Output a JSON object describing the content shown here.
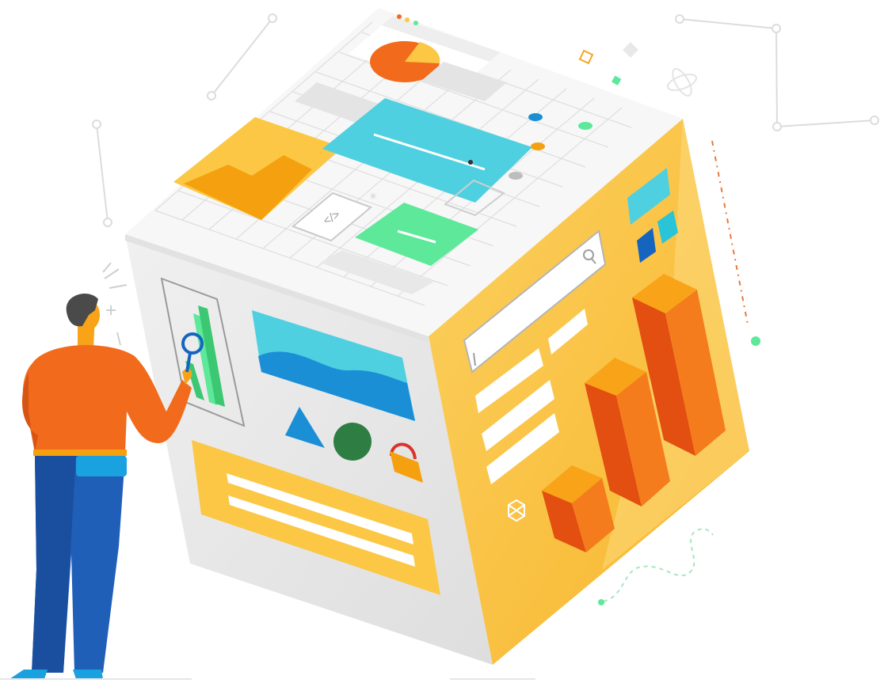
{
  "illustration": {
    "subject": "isometric-ui-cube-with-person",
    "colors": {
      "top_face": "#f6f6f6",
      "left_face": "#e9e9e9",
      "right_face": "#fbc744",
      "accent_orange": "#f26b1d",
      "accent_cyan": "#4fd0e0",
      "accent_green": "#5de89a",
      "accent_blue": "#1565c0",
      "accent_yellow": "#fbc744",
      "dark_green": "#2e7d43",
      "person_shirt": "#f26b1d",
      "person_pants": "#1f5fb8",
      "person_hair": "#4a4a4a",
      "line_gray": "#dadada"
    },
    "icons": [
      "pie-chart-icon",
      "image-icon",
      "code-icon",
      "search-icon",
      "bar-chart-icon",
      "padlock-icon",
      "triangle-icon",
      "magnifying-glass-icon",
      "atom-icon",
      "hexagon-icon"
    ],
    "bar_chart_levels": [
      0.25,
      0.6,
      0.85
    ]
  }
}
